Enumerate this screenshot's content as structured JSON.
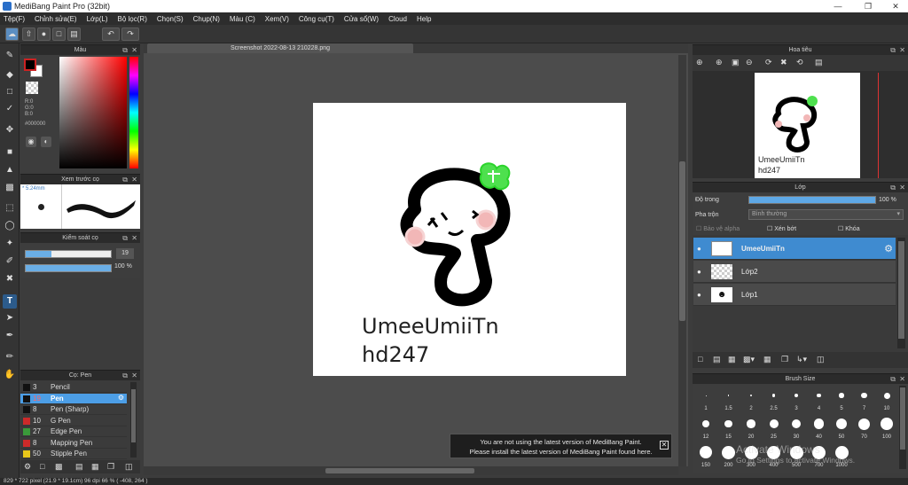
{
  "app": {
    "title": "MediBang Paint Pro (32bit)"
  },
  "menu": [
    "Tệp(F)",
    "Chỉnh sửa(E)",
    "Lớp(L)",
    "Bộ lọc(R)",
    "Chọn(S)",
    "Chụp(N)",
    "Màu (C)",
    "Xem(V)",
    "Công cụ(T)",
    "Cửa sổ(W)",
    "Cloud",
    "Help"
  ],
  "document": {
    "tab": "Screenshot 2022-08-13 210228.png",
    "text_line1": "UmeeUmiiTn",
    "text_line2": "hd247"
  },
  "color_panel": {
    "title": "Màu",
    "r": "R:0",
    "g": "G:0",
    "b": "B:0",
    "hex": "#000000"
  },
  "brush_preview": {
    "title": "Xem trước cọ",
    "size": "* 5.24mm"
  },
  "brush_control": {
    "title": "Kiểm soát cọ",
    "size_value": "19",
    "opacity_value": "100 %",
    "size_level": 0.3,
    "opacity_level": 1.0
  },
  "brush_panel": {
    "title": "Cọ: Pen",
    "items": [
      {
        "size": "3",
        "name": "Pencil",
        "color": "#111111"
      },
      {
        "size": "19",
        "name": "Pen",
        "color": "#111111"
      },
      {
        "size": "8",
        "name": "Pen (Sharp)",
        "color": "#111111"
      },
      {
        "size": "10",
        "name": "G Pen",
        "color": "#cc2a2a"
      },
      {
        "size": "27",
        "name": "Edge Pen",
        "color": "#3a9a3a"
      },
      {
        "size": "8",
        "name": "Mapping Pen",
        "color": "#cc2a2a"
      },
      {
        "size": "50",
        "name": "Stipple Pen",
        "color": "#e8c61a"
      }
    ]
  },
  "navigator": {
    "title": "Hoa tiêu",
    "text_line1": "UmeeUmiiTn",
    "text_line2": "hd247"
  },
  "layers": {
    "title": "Lớp",
    "opacity_label": "Độ trong",
    "opacity_value": "100 %",
    "blend_label": "Pha trộn",
    "blend_value": "Bình thường",
    "protect_alpha": "Bảo vệ alpha",
    "clipping": "Xén bớt",
    "lock": "Khóa",
    "items": [
      {
        "name": "UmeeUmiiTn"
      },
      {
        "name": "Lớp2"
      },
      {
        "name": "Lớp1"
      }
    ]
  },
  "brush_size": {
    "title": "Brush Size",
    "sizes": [
      "1",
      "1.5",
      "2",
      "2.5",
      "3",
      "4",
      "5",
      "7",
      "10",
      "12",
      "15",
      "20",
      "25",
      "30",
      "40",
      "50",
      "70",
      "100",
      "150",
      "200",
      "300",
      "400",
      "500",
      "700",
      "1000"
    ]
  },
  "notification": {
    "line1": "You are not using the latest version of MediBang Paint.",
    "line2": "Please install the latest version of MediBang Paint found here."
  },
  "watermark": {
    "line1": "Activate Windows",
    "line2": "Go to Settings to activate Windows."
  },
  "statusbar": {
    "text": "829 * 722 pixel   (21.9 * 19.1cm)   96 dpi   66 %   ( -408, 264 )"
  }
}
